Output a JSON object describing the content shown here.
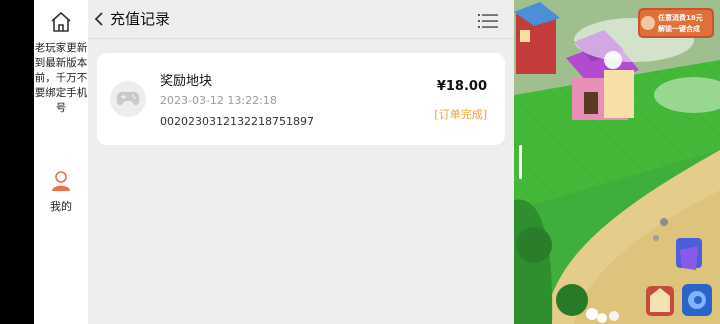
{
  "sidebar": {
    "notice": "老玩家更新到最新版本前，千万不要绑定手机号",
    "me_label": "我的"
  },
  "header": {
    "title": "充值记录"
  },
  "record": {
    "name": "奖励地块",
    "date": "2023-03-12 13:22:18",
    "order_no": "002023031213221875189​7",
    "price": "¥18.00",
    "status": "[订单完成]"
  },
  "game": {
    "promo_line1": "任意消费18元",
    "promo_line2": "解锁一键合成"
  },
  "icons": {
    "home": "home-icon",
    "user": "user-icon",
    "back": "chevron-left-icon",
    "menu": "list-menu-icon",
    "game": "gamepad-icon"
  },
  "colors": {
    "status": "#f2a23a",
    "avatar": "#e8704a"
  }
}
